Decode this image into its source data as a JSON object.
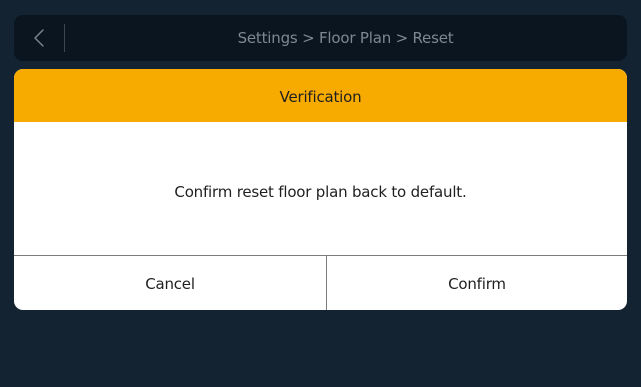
{
  "header": {
    "breadcrumb": "Settings > Floor Plan > Reset",
    "back_icon": "chevron-left-icon"
  },
  "dialog": {
    "title": "Verification",
    "message": "Confirm reset floor plan back to default.",
    "cancel_label": "Cancel",
    "confirm_label": "Confirm"
  },
  "colors": {
    "background": "#132331",
    "header_bg": "#0a1520",
    "accent": "#f7ab00",
    "dialog_bg": "#ffffff",
    "breadcrumb_text": "#7d8893"
  }
}
